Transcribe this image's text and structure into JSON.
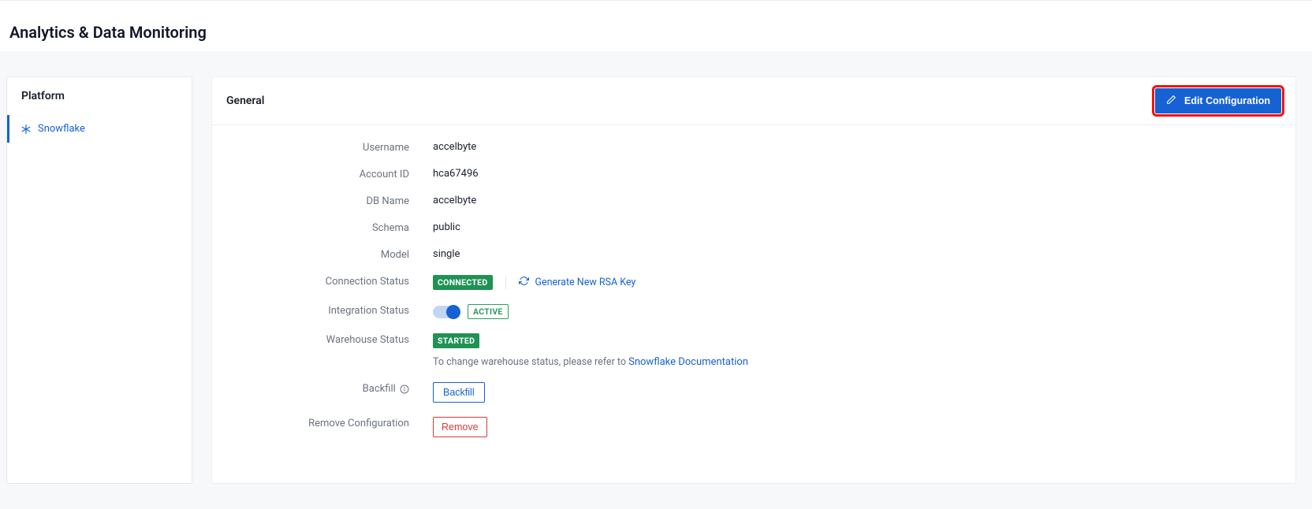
{
  "page": {
    "title": "Analytics & Data Monitoring"
  },
  "sidebar": {
    "title": "Platform",
    "items": [
      {
        "label": "Snowflake"
      }
    ]
  },
  "main": {
    "section_title": "General",
    "edit_button_label": "Edit Configuration"
  },
  "fields": {
    "username": {
      "label": "Username",
      "value": "accelbyte"
    },
    "account_id": {
      "label": "Account ID",
      "value": "hca67496"
    },
    "db_name": {
      "label": "DB Name",
      "value": "accelbyte"
    },
    "schema": {
      "label": "Schema",
      "value": "public"
    },
    "model": {
      "label": "Model",
      "value": "single"
    },
    "connection_status": {
      "label": "Connection Status",
      "badge": "CONNECTED",
      "action": "Generate New RSA Key"
    },
    "integration_status": {
      "label": "Integration Status",
      "badge": "ACTIVE",
      "enabled": true
    },
    "warehouse_status": {
      "label": "Warehouse Status",
      "badge": "STARTED",
      "help_prefix": "To change warehouse status, please refer to ",
      "doc_link": "Snowflake Documentation"
    },
    "backfill": {
      "label": "Backfill",
      "button": "Backfill"
    },
    "remove": {
      "label": "Remove Configuration",
      "button": "Remove"
    }
  }
}
